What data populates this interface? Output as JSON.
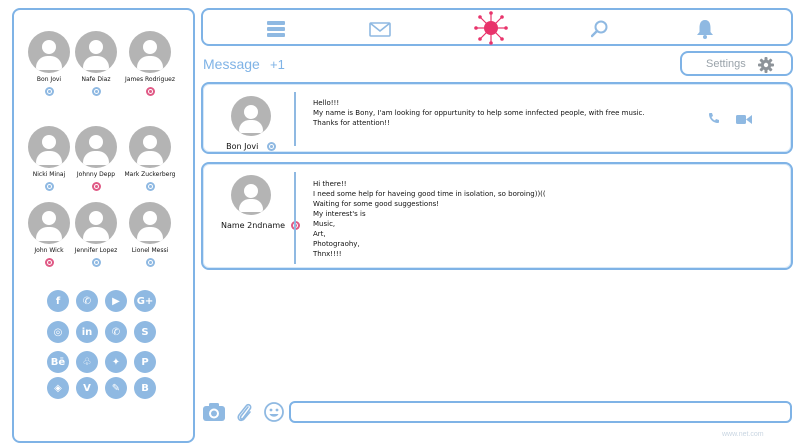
{
  "sidebar": {
    "contacts": [
      {
        "name": "Bon Jovi",
        "status": "online"
      },
      {
        "name": "Nafe Diaz",
        "status": "online"
      },
      {
        "name": "James Rodriguez",
        "status": "offline"
      },
      {
        "name": "Nicki Minaj",
        "status": "online"
      },
      {
        "name": "Johnny Depp",
        "status": "offline"
      },
      {
        "name": "Mark Zuckerberg",
        "status": "online"
      },
      {
        "name": "John Wick",
        "status": "offline"
      },
      {
        "name": "Jennifer Lopez",
        "status": "online"
      },
      {
        "name": "Lionel Messi",
        "status": "online"
      }
    ],
    "social_icons": [
      {
        "icon": "facebook-icon",
        "glyph": "f"
      },
      {
        "icon": "whatsapp-icon",
        "glyph": "✆"
      },
      {
        "icon": "youtube-icon",
        "glyph": "▶"
      },
      {
        "icon": "google-plus-icon",
        "glyph": "G+"
      },
      {
        "icon": "instagram-icon",
        "glyph": "◎"
      },
      {
        "icon": "linkedin-icon",
        "glyph": "in"
      },
      {
        "icon": "whatsapp-icon",
        "glyph": "✆"
      },
      {
        "icon": "skype-icon",
        "glyph": "S"
      },
      {
        "icon": "behance-icon",
        "glyph": "Bē"
      },
      {
        "icon": "snapchat-icon",
        "glyph": "♧"
      },
      {
        "icon": "twitter-icon",
        "glyph": "✦"
      },
      {
        "icon": "pinterest-icon",
        "glyph": "P"
      },
      {
        "icon": "dropbox-icon",
        "glyph": "◈"
      },
      {
        "icon": "vimeo-icon",
        "glyph": "V"
      },
      {
        "icon": "evernote-icon",
        "glyph": "✎"
      },
      {
        "icon": "blogger-icon",
        "glyph": "B"
      }
    ]
  },
  "topnav": {
    "icons": [
      "menu-icon",
      "mail-icon",
      "virus-icon",
      "search-icon",
      "bell-icon"
    ]
  },
  "messages_header": {
    "title": "Message",
    "count": "+1",
    "settings_label": "Settings"
  },
  "messages": [
    {
      "sender": "Bon Jovi",
      "status": "online",
      "lines": [
        "Hello!!!",
        "My name is Bony, I'am looking for oppurtunity to help some innfected people, with free music.",
        "Thanks for attention!!"
      ]
    },
    {
      "sender": "Name 2ndname",
      "status": "offline",
      "lines": [
        "Hi there!!",
        "I need some help for haveing good time in isolation, so boroing))((",
        "Waiting for some good suggestions!",
        "My interest's is",
        "Music,",
        "Art,",
        "Photograohy,",
        "Thnx!!!!"
      ]
    }
  ],
  "compose": {
    "placeholder": ""
  },
  "footer": {
    "watermark": "www.net.com"
  },
  "colors": {
    "accent": "#7fb3e6",
    "online": "#8fb9e2",
    "offline": "#e05a86",
    "virus": "#e8336b"
  }
}
